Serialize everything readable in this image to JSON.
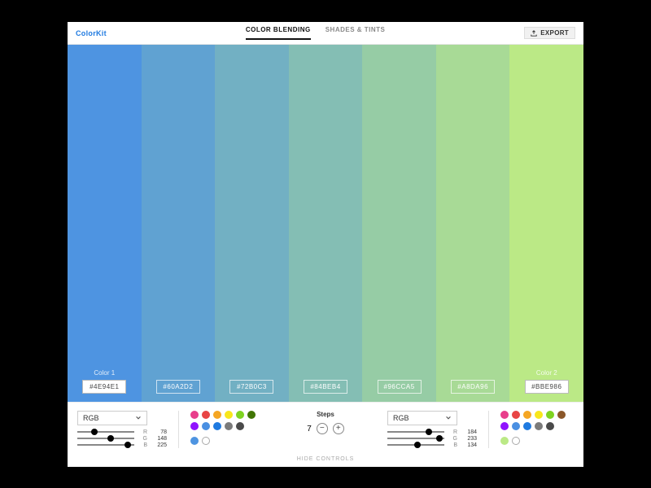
{
  "header": {
    "logo": "ColorKit",
    "tabs": [
      {
        "label": "COLOR BLENDING",
        "active": true
      },
      {
        "label": "SHADES & TINTS",
        "active": false
      }
    ],
    "export_label": "EXPORT"
  },
  "swatches": [
    {
      "title": "Color 1",
      "hex": "#4E94E1",
      "editable": true
    },
    {
      "title": "",
      "hex": "#60A2D2",
      "editable": false
    },
    {
      "title": "",
      "hex": "#72B0C3",
      "editable": false
    },
    {
      "title": "",
      "hex": "#84BEB4",
      "editable": false
    },
    {
      "title": "",
      "hex": "#96CCA5",
      "editable": false
    },
    {
      "title": "",
      "hex": "#A8DA96",
      "editable": false
    },
    {
      "title": "Color 2",
      "hex": "#BBE986",
      "editable": true
    }
  ],
  "controls": {
    "left": {
      "mode": "RGB",
      "rgb": {
        "R": 78,
        "G": 148,
        "B": 225
      },
      "chips": [
        "#e83e8c",
        "#e84545",
        "#f5a623",
        "#f8e71c",
        "#7ed321",
        "#417505",
        "#9013fe",
        "#4a90e2",
        "#1f7ae0",
        "#7b7b7b",
        "#4a4a4a",
        "#ffffff"
      ],
      "recent": [
        "#4E94E1",
        "#ffffff"
      ]
    },
    "steps": {
      "label": "Steps",
      "value": 7
    },
    "right": {
      "mode": "RGB",
      "rgb": {
        "R": 184,
        "G": 233,
        "B": 134
      },
      "chips": [
        "#e83e8c",
        "#e84545",
        "#f5a623",
        "#f8e71c",
        "#7ed321",
        "#8b572a",
        "#9013fe",
        "#4a90e2",
        "#1f7ae0",
        "#7b7b7b",
        "#4a4a4a",
        "#ffffff"
      ],
      "recent": [
        "#BBE986",
        "#ffffff"
      ]
    },
    "hide_label": "HIDE CONTROLS"
  }
}
